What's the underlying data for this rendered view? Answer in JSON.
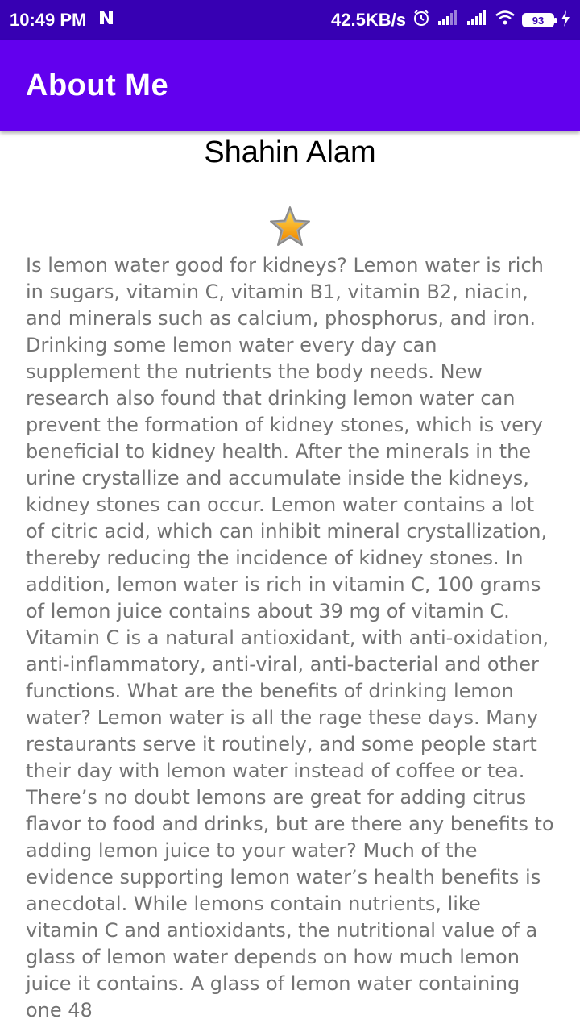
{
  "status_bar": {
    "time": "10:49 PM",
    "network_speed": "42.5KB/s",
    "battery": "93",
    "notification_icon": "n-icon",
    "icons": [
      "alarm-icon",
      "signal-icon",
      "signal-icon",
      "wifi-icon",
      "battery-icon",
      "charging-icon"
    ]
  },
  "app_bar": {
    "title": "About Me",
    "color": "#6200ee"
  },
  "profile": {
    "name": "Shahin Alam",
    "rating_icon": "star-icon"
  },
  "bio": {
    "text": "Is lemon water good for kidneys? Lemon water is rich in sugars, vitamin C, vitamin B1, vitamin B2, niacin, and minerals such as calcium, phosphorus, and iron. Drinking some lemon water every day can supplement the nutrients the body needs. New research also found that drinking lemon water can prevent the formation of kidney stones, which is very beneficial to kidney health. After the minerals in the urine crystallize and accumulate inside the kidneys, kidney stones can occur. Lemon water contains a lot of citric acid, which can inhibit mineral crystallization, thereby reducing the incidence of kidney stones. In addition, lemon water is rich in vitamin C, 100 grams of lemon juice contains about 39 mg of vitamin C. Vitamin C is a natural antioxidant, with anti-oxidation, anti-inflammatory, anti-viral, anti-bacterial and other functions. What are the benefits of drinking lemon water? Lemon water is all the rage these days. Many restaurants serve it routinely, and some people start their day with lemon water instead of coffee or tea. There’s no doubt lemons are great for adding citrus flavor to food and drinks, but are there any benefits to adding lemon juice to your water? Much of the evidence supporting lemon water’s health benefits is anecdotal. While lemons contain nutrients, like vitamin C and antioxidants, the nutritional value of a glass of lemon water depends on how much lemon juice it contains. A glass of lemon water containing one 48"
  }
}
